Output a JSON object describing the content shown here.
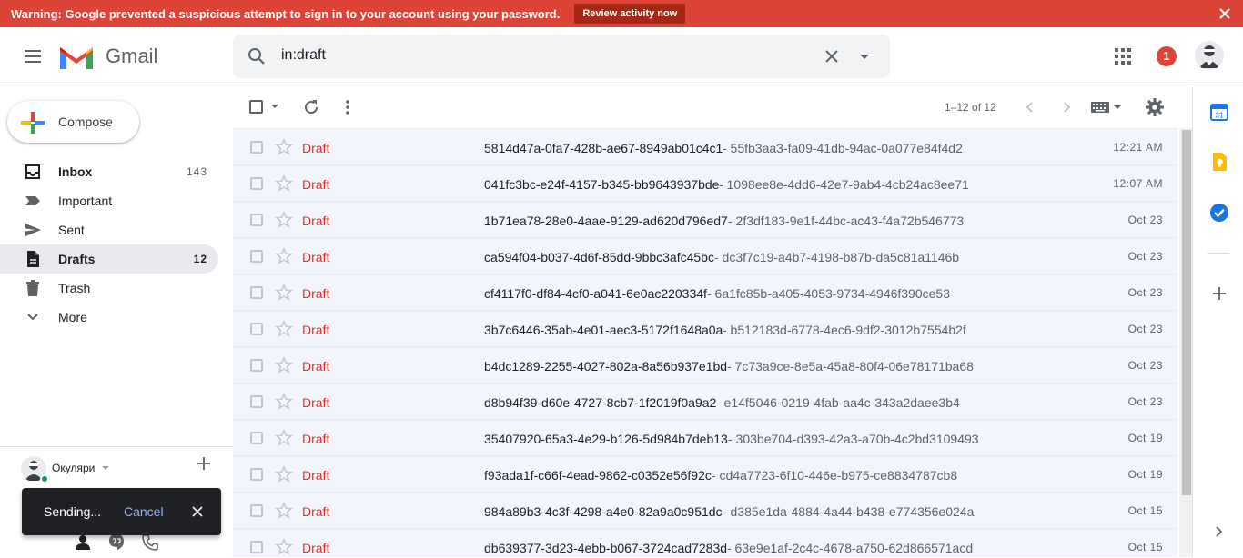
{
  "warning": {
    "text": "Warning: Google prevented a suspicious attempt to sign in to your account using your password.",
    "button": "Review activity now",
    "bg_color": "#db4437"
  },
  "header": {
    "app_name": "Gmail",
    "search_value": "in:draft",
    "notification_count": "1"
  },
  "sidebar": {
    "compose_label": "Compose",
    "items": [
      {
        "label": "Inbox",
        "count": "143",
        "icon": "inbox-icon"
      },
      {
        "label": "Important",
        "count": "",
        "icon": "important-icon"
      },
      {
        "label": "Sent",
        "count": "",
        "icon": "send-icon"
      },
      {
        "label": "Drafts",
        "count": "12",
        "icon": "draft-icon"
      },
      {
        "label": "Trash",
        "count": "",
        "icon": "trash-icon"
      },
      {
        "label": "More",
        "count": "",
        "icon": "chevron-down-icon"
      }
    ],
    "hangouts_user": "Окуляри"
  },
  "snackbar": {
    "text": "Sending...",
    "action": "Cancel"
  },
  "toolbar": {
    "range": "1–12 of 12"
  },
  "emails": [
    {
      "sender": "Draft",
      "subject": "5814d47a-0fa7-428b-ae67-8949ab01c4c1",
      "snippet": " - 55fb3aa3-fa09-41db-94ac-0a077e84f4d2",
      "date": "12:21 AM"
    },
    {
      "sender": "Draft",
      "subject": "041fc3bc-e24f-4157-b345-bb9643937bde",
      "snippet": " - 1098ee8e-4dd6-42e7-9ab4-4cb24ac8ee71",
      "date": "12:07 AM"
    },
    {
      "sender": "Draft",
      "subject": "1b71ea78-28e0-4aae-9129-ad620d796ed7",
      "snippet": " - 2f3df183-9e1f-44bc-ac43-f4a72b546773",
      "date": "Oct 23"
    },
    {
      "sender": "Draft",
      "subject": "ca594f04-b037-4d6f-85dd-9bbc3afc45bc",
      "snippet": " - dc3f7c19-a4b7-4198-b87b-da5c81a1146b",
      "date": "Oct 23"
    },
    {
      "sender": "Draft",
      "subject": "cf4117f0-df84-4cf0-a041-6e0ac220334f",
      "snippet": " - 6a1fc85b-a405-4053-9734-4946f390ce53",
      "date": "Oct 23"
    },
    {
      "sender": "Draft",
      "subject": "3b7c6446-35ab-4e01-aec3-5172f1648a0a",
      "snippet": " - b512183d-6778-4ec6-9df2-3012b7554b2f",
      "date": "Oct 23"
    },
    {
      "sender": "Draft",
      "subject": "b4dc1289-2255-4027-802a-8a56b937e1bd",
      "snippet": " - 7c73a9ce-8e5a-45a8-80f4-06e78171ba68",
      "date": "Oct 23"
    },
    {
      "sender": "Draft",
      "subject": "d8b94f39-d60e-4727-8cb7-1f2019f0a9a2",
      "snippet": " - e14f5046-0219-4fab-aa4c-343a2daee3b4",
      "date": "Oct 23"
    },
    {
      "sender": "Draft",
      "subject": "35407920-65a3-4e29-b126-5d984b7deb13",
      "snippet": " - 303be704-d393-42a3-a70b-4c2bd3109493",
      "date": "Oct 19"
    },
    {
      "sender": "Draft",
      "subject": "f93ada1f-c66f-4ead-9862-c0352e56f92c",
      "snippet": " - cd4a7723-6f10-446e-b975-ce8834787cb8",
      "date": "Oct 19"
    },
    {
      "sender": "Draft",
      "subject": "984a89b3-4c3f-4298-a4e0-82a9a0c951dc",
      "snippet": " - d385e1da-4884-4a44-b438-e774356e024a",
      "date": "Oct 15"
    },
    {
      "sender": "Draft",
      "subject": "db639377-3d23-4ebb-b067-3724cad7283d",
      "snippet": " - 63e9e1af-2c4c-4678-a750-62d866571acd",
      "date": "Oct 15"
    }
  ],
  "colors": {
    "draft_label": "#d93025",
    "active_nav": "#e8eaed",
    "row_bg": "#f2f6fc"
  }
}
